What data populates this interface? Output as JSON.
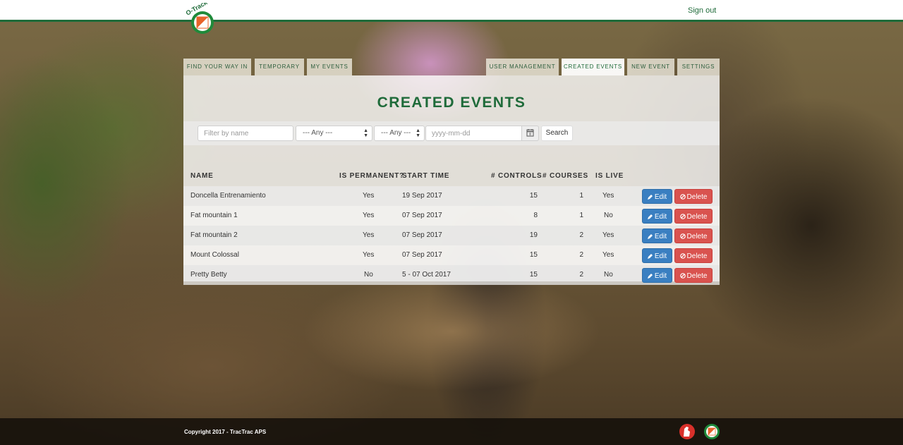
{
  "brand": {
    "logo_text": "O-Track"
  },
  "header": {
    "signout_label": "Sign out"
  },
  "tabs_left": [
    {
      "label": "Find your way in"
    },
    {
      "label": "Temporary"
    },
    {
      "label": "My events"
    }
  ],
  "tabs_right": [
    {
      "label": "User management"
    },
    {
      "label": "Created events"
    },
    {
      "label": "New event"
    },
    {
      "label": "Settings"
    }
  ],
  "page": {
    "title": "CREATED EVENTS"
  },
  "filters": {
    "name_placeholder": "Filter by name",
    "select1_value": "--- Any ---",
    "select2_value": "--- Any ---",
    "date_placeholder": "yyyy-mm-dd",
    "search_label": "Search"
  },
  "table": {
    "headers": {
      "name": "NAME",
      "permanent": "IS PERMANENT?",
      "start": "START TIME",
      "controls": "# CONTROLS",
      "courses": "# COURSES",
      "live": "IS LIVE"
    },
    "edit_label": "Edit",
    "delete_label": "Delete",
    "rows": [
      {
        "name": "Doncella Entrenamiento",
        "permanent": "Yes",
        "start": "19 Sep 2017",
        "controls": "15",
        "courses": "1",
        "live": "Yes"
      },
      {
        "name": "Fat mountain 1",
        "permanent": "Yes",
        "start": "07 Sep 2017",
        "controls": "8",
        "courses": "1",
        "live": "No"
      },
      {
        "name": "Fat mountain 2",
        "permanent": "Yes",
        "start": "07 Sep 2017",
        "controls": "19",
        "courses": "2",
        "live": "Yes"
      },
      {
        "name": "Mount Colossal",
        "permanent": "Yes",
        "start": "07 Sep 2017",
        "controls": "15",
        "courses": "2",
        "live": "Yes"
      },
      {
        "name": "Pretty Betty",
        "permanent": "No",
        "start": "5 - 07 Oct 2017",
        "controls": "15",
        "courses": "2",
        "live": "No"
      }
    ]
  },
  "footer": {
    "copyright": "Copyright 2017 - TracTrac APS"
  },
  "colors": {
    "brand_green": "#1f6b3a",
    "edit_blue": "#3a7fc1",
    "delete_red": "#d9534f",
    "logo_orange": "#e8632a"
  }
}
